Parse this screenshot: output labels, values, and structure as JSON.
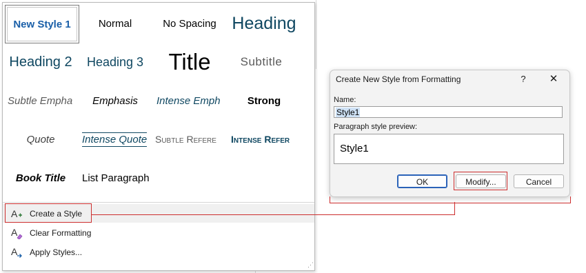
{
  "style_gallery": {
    "tiles": [
      {
        "label": "New Style 1",
        "style_hint": "selected bold blue"
      },
      {
        "label": "Normal"
      },
      {
        "label": "No Spacing"
      },
      {
        "label": "Heading"
      },
      {
        "label": "Heading 2"
      },
      {
        "label": "Heading 3"
      },
      {
        "label": "Title"
      },
      {
        "label": "Subtitle"
      },
      {
        "label": "Subtle Empha"
      },
      {
        "label": "Emphasis"
      },
      {
        "label": "Intense Emph"
      },
      {
        "label": "Strong"
      },
      {
        "label": "Quote"
      },
      {
        "label": "Intense Quote"
      },
      {
        "label": "Subtle Refere"
      },
      {
        "label": "Intense Refer"
      },
      {
        "label": "Book Title"
      },
      {
        "label": "List Paragraph"
      }
    ],
    "menu": [
      {
        "label": "Create a Style",
        "icon": "create-style-icon"
      },
      {
        "label": "Clear Formatting",
        "icon": "clear-formatting-icon"
      },
      {
        "label": "Apply Styles...",
        "icon": "apply-styles-icon"
      }
    ]
  },
  "dialog": {
    "title": "Create New Style from Formatting",
    "help_label": "?",
    "close_label": "✕",
    "name_label": "Name:",
    "name_value": "Style1",
    "preview_label": "Paragraph style preview:",
    "preview_text": "Style1",
    "ok_label": "OK",
    "modify_label": "Modify...",
    "cancel_label": "Cancel"
  },
  "colors": {
    "heading_blue": "#0f4761",
    "accent_blue": "#1a5fa8",
    "annotation_red": "#cc2d2d"
  }
}
